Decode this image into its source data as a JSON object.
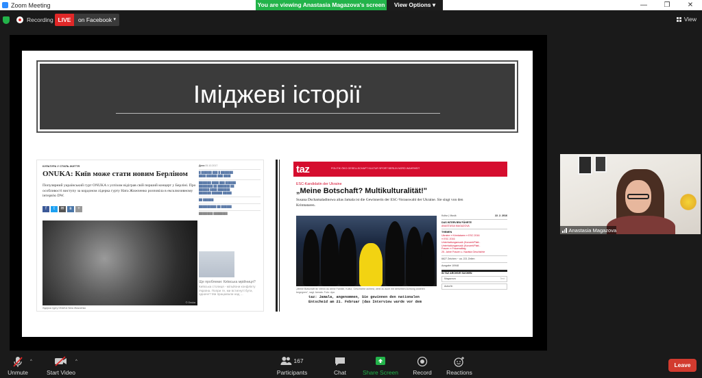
{
  "window": {
    "title": "Zoom Meeting"
  },
  "banner": {
    "viewing": "You are viewing Anastasia Magazova's screen",
    "view_options": "View Options ▾"
  },
  "controls": {
    "minimize": "—",
    "maximize": "❐",
    "close": "✕"
  },
  "topbar": {
    "recording": "Recording",
    "live": "LIVE",
    "live_target": "on Facebook",
    "view": "View"
  },
  "slide": {
    "title": "Іміджеві історії",
    "dw": {
      "category": "КУЛЬТУРА У СТИЛЬ ЖИТТЯ",
      "headline": "ONUKA: Київ може стати новим Берліном",
      "lead": "Популярний український гурт ONUKA з успіхом відіграв свій перший концерт у Берліні. Про особливості виступу за кордоном лідерка гурту Ната Жижченко розповіла в ексклюзивному інтерв'ю DW.",
      "caption": "Лідерка гурту ONUKA Ната Жижченко",
      "watermark": "© Onuka",
      "sidebar_label": "Дата",
      "sidebar_date": "05.10.2017",
      "sidebar_related": "Ще проблеми: Київська мрійниця?",
      "sidebar_teaser": "Київська столиця - мільйони конфлікту Україна. Попри те, ми встигнуті бути, одначе? Ми працювали над ..."
    },
    "taz": {
      "logo": "taz",
      "nav": "POLITIK  ÖKO  GESELLSCHAFT  KULTUR  SPORT  BERLIN  NORD  WAHRHEIT",
      "kicker": "ESC-Kandidatin der Ukraine",
      "headline": "„Meine Botschaft? Multikulturalität!\"",
      "lead": "Susana Dschamaladinowa alias Jamala ist die Gewinnerin der ESC-Vorauswahl der Ukraine. Sie singt von den Krimtataren.",
      "caption": "„Meine Botschaft ist: Wenn du deine Familie, Kultur, Geschichte achtest, wirst du auch mit derselben Achtung anderen begegnen\", sagt Jamala.",
      "credit": "Foto: dpa",
      "body": "taz: Jamala, angenommen, Sie gewinnen den nationalen Entscheid am 21. Februar (das Interview wurde vor dem",
      "right": {
        "section": "Kultur | Musik",
        "date": "22. 2. 2016",
        "label1": "DAS INTERVIEW FÜHRTE",
        "author": "ANASTASIA MAGAZOVA",
        "themen": "THEMEN",
        "tags": [
          "Ukraine   ≡ Krimtataren   ≡ ESC 2016",
          "≡ ESC 2016",
          "Unterhaltungsmusik (Konzert/Platt..",
          "Unterhaltungsmusik (Konzert/Platt..",
          "Frauen ≡ Frauenalltag",
          "25. Jahre Frauen u. Nazista Geschichte"
        ],
        "stats": [
          "6627 Zeichen",
          "~ ca. 221 Zeilen"
        ],
        "ausgabe": "Ausgabe 10948",
        "archive": "IN TAZ ARCHIVE SUCHEN",
        "search": "Magazova",
        "search_btn": "Text",
        "autor": "Autor/in"
      }
    }
  },
  "camera": {
    "name": "Anastasia Magazova"
  },
  "toolbar": {
    "unmute": "Unmute",
    "start_video": "Start Video",
    "participants": "Participants",
    "participants_count": "167",
    "chat": "Chat",
    "share": "Share Screen",
    "record": "Record",
    "reactions": "Reactions",
    "leave": "Leave"
  },
  "colors": {
    "accent_green": "#23b34a",
    "live_red": "#e02828",
    "taz_red": "#d50d2e",
    "leave_red": "#d23b2f"
  }
}
